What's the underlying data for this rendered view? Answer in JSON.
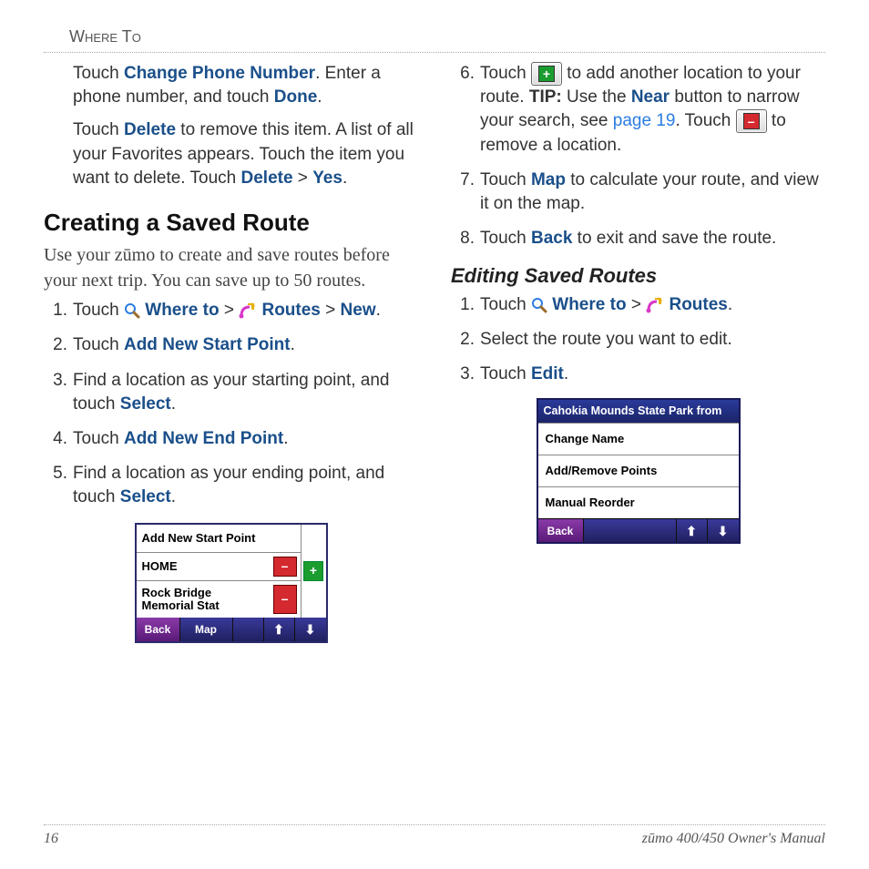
{
  "header": "Where To",
  "left": {
    "p1_a": "Touch ",
    "p1_b": "Change Phone Number",
    "p1_c": ". Enter a phone number, and touch ",
    "p1_d": "Done",
    "p1_e": ".",
    "p2_a": "Touch ",
    "p2_b": "Delete",
    "p2_c": " to remove this item. A list of all your Favorites appears. Touch the item you want to delete. Touch ",
    "p2_d": "Delete",
    "p2_e": " > ",
    "p2_f": "Yes",
    "p2_g": ".",
    "h2": "Creating a Saved Route",
    "desc": "Use your zūmo to create and save routes before your next trip. You can save up to 50 routes.",
    "steps": {
      "s1_a": "Touch ",
      "s1_b": "Where to",
      "s1_c": " > ",
      "s1_d": "Routes",
      "s1_e": " > ",
      "s1_f": "New",
      "s1_g": ".",
      "s2_a": "Touch ",
      "s2_b": "Add New Start Point",
      "s2_c": ".",
      "s3": "Find a location as your starting point, and touch ",
      "s3_b": "Select",
      "s3_c": ".",
      "s4_a": "Touch ",
      "s4_b": "Add New End Point",
      "s4_c": ".",
      "s5": "Find a location as your ending point, and touch ",
      "s5_b": "Select",
      "s5_c": "."
    }
  },
  "right": {
    "s6_a": "Touch ",
    "s6_b": " to add another location to your route. ",
    "s6_tip": "TIP:",
    "s6_c": " Use the ",
    "s6_d": "Near",
    "s6_e": " button to narrow your search, see ",
    "s6_f": "page 19",
    "s6_g": ". Touch ",
    "s6_h": " to remove a location.",
    "s7_a": "Touch ",
    "s7_b": "Map",
    "s7_c": " to calculate your route, and view it on the map.",
    "s8_a": "Touch ",
    "s8_b": "Back",
    "s8_c": " to exit and save the route.",
    "h3": "Editing Saved Routes",
    "e1_a": "Touch ",
    "e1_b": "Where to",
    "e1_c": " > ",
    "e1_d": "Routes",
    "e1_e": ".",
    "e2": "Select the route you want to edit.",
    "e3_a": "Touch ",
    "e3_b": "Edit",
    "e3_c": "."
  },
  "device1": {
    "r1": "Add New Start Point",
    "r2": "HOME",
    "r3": "Rock Bridge Memorial Stat",
    "back": "Back",
    "map": "Map"
  },
  "device2": {
    "title": "Cahokia Mounds State Park from",
    "r1": "Change Name",
    "r2": "Add/Remove Points",
    "r3": "Manual Reorder",
    "back": "Back"
  },
  "footer": {
    "page": "16",
    "manual": "zūmo 400/450 Owner's Manual"
  },
  "glyphs": {
    "plus": "+",
    "minus": "–",
    "up": "⬆",
    "down": "⬇"
  }
}
